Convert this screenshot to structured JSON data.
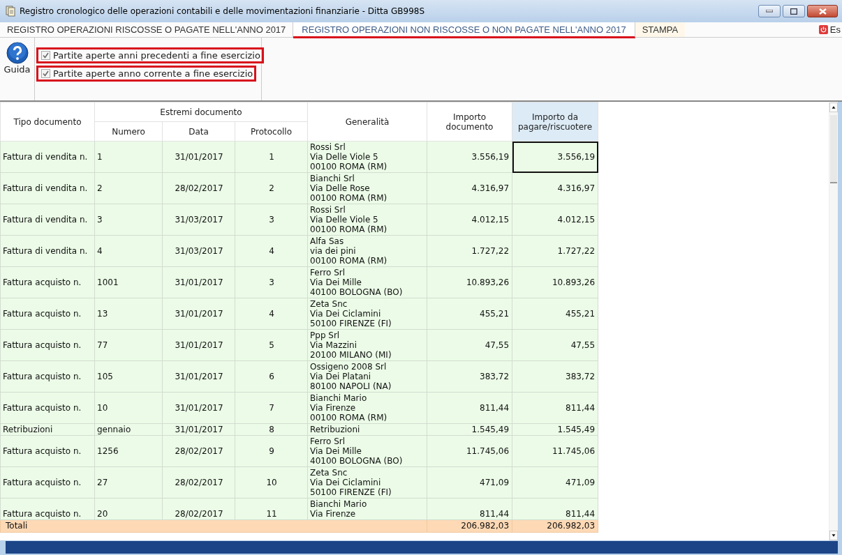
{
  "window": {
    "title": "Registro cronologico delle operazioni contabili e delle movimentazioni finanziarie - Ditta GB998S"
  },
  "tabs": [
    {
      "label": "REGISTRO OPERAZIONI RISCOSSE O PAGATE NELL'ANNO 2017",
      "selected": false
    },
    {
      "label": "REGISTRO OPERAZIONI NON RISCOSSE O NON PAGATE NELL'ANNO 2017",
      "selected": true
    },
    {
      "label": "STAMPA",
      "selected": false
    }
  ],
  "exit_button": {
    "label": "Es"
  },
  "toolbar": {
    "help_button": {
      "label": "Guida"
    },
    "filters": [
      {
        "label": "Partite aperte anni precedenti a fine esercizio",
        "checked": true
      },
      {
        "label": "Partite aperte anno corrente a fine esercizio",
        "checked": true
      }
    ]
  },
  "table": {
    "group_header": "Estremi documento",
    "columns": [
      {
        "label": "Tipo documento",
        "selected": false
      },
      {
        "label": "Numero",
        "selected": false
      },
      {
        "label": "Data",
        "selected": false
      },
      {
        "label": "Protocollo",
        "selected": false
      },
      {
        "label": "Generalità",
        "selected": false
      },
      {
        "label": "Importo documento",
        "selected": false
      },
      {
        "label": "Importo da pagare/riscuotere",
        "selected": true
      }
    ],
    "rows": [
      {
        "type": "Fattura di vendita n.",
        "number": "1",
        "date": "31/01/2017",
        "protocol": "1",
        "party": [
          "Rossi Srl",
          "Via Delle Viole 5",
          "00100 ROMA (RM)"
        ],
        "amount": "3.556,19",
        "due": "3.556,19",
        "selected": true
      },
      {
        "type": "Fattura di vendita n.",
        "number": "2",
        "date": "28/02/2017",
        "protocol": "2",
        "party": [
          "Bianchi Srl",
          "Via Delle Rose",
          "00100 ROMA (RM)"
        ],
        "amount": "4.316,97",
        "due": "4.316,97",
        "selected": false
      },
      {
        "type": "Fattura di vendita n.",
        "number": "3",
        "date": "31/03/2017",
        "protocol": "3",
        "party": [
          "Rossi Srl",
          "Via Delle Viole 5",
          "00100 ROMA (RM)"
        ],
        "amount": "4.012,15",
        "due": "4.012,15",
        "selected": false
      },
      {
        "type": "Fattura di vendita n.",
        "number": "4",
        "date": "31/03/2017",
        "protocol": "4",
        "party": [
          "Alfa Sas",
          "via dei pini",
          "00100 ROMA (RM)"
        ],
        "amount": "1.727,22",
        "due": "1.727,22",
        "selected": false
      },
      {
        "type": "Fattura acquisto n.",
        "number": "1001",
        "date": "31/01/2017",
        "protocol": "3",
        "party": [
          "Ferro Srl",
          "Via Dei Mille",
          "40100 BOLOGNA (BO)"
        ],
        "amount": "10.893,26",
        "due": "10.893,26",
        "selected": false
      },
      {
        "type": "Fattura acquisto n.",
        "number": "13",
        "date": "31/01/2017",
        "protocol": "4",
        "party": [
          "Zeta Snc",
          "Via Dei Ciclamini",
          "50100 FIRENZE (FI)"
        ],
        "amount": "455,21",
        "due": "455,21",
        "selected": false
      },
      {
        "type": "Fattura acquisto n.",
        "number": "77",
        "date": "31/01/2017",
        "protocol": "5",
        "party": [
          "Ppp Srl",
          "Via Mazzini",
          "20100 MILANO (MI)"
        ],
        "amount": "47,55",
        "due": "47,55",
        "selected": false
      },
      {
        "type": "Fattura acquisto n.",
        "number": "105",
        "date": "31/01/2017",
        "protocol": "6",
        "party": [
          "Ossigeno 2008 Srl",
          "Via Dei Platani",
          "80100 NAPOLI (NA)"
        ],
        "amount": "383,72",
        "due": "383,72",
        "selected": false
      },
      {
        "type": "Fattura acquisto n.",
        "number": "10",
        "date": "31/01/2017",
        "protocol": "7",
        "party": [
          "Bianchi Mario",
          "Via Firenze",
          "00100 ROMA (RM)"
        ],
        "amount": "811,44",
        "due": "811,44",
        "selected": false
      },
      {
        "type": "Retribuzioni",
        "number": "gennaio",
        "date": "31/01/2017",
        "protocol": "8",
        "party": [
          "Retribuzioni"
        ],
        "amount": "1.545,49",
        "due": "1.545,49",
        "selected": false
      },
      {
        "type": "Fattura acquisto n.",
        "number": "1256",
        "date": "28/02/2017",
        "protocol": "9",
        "party": [
          "Ferro Srl",
          "Via Dei Mille",
          "40100 BOLOGNA (BO)"
        ],
        "amount": "11.745,06",
        "due": "11.745,06",
        "selected": false
      },
      {
        "type": "Fattura acquisto n.",
        "number": "27",
        "date": "28/02/2017",
        "protocol": "10",
        "party": [
          "Zeta Snc",
          "Via Dei Ciclamini",
          "50100 FIRENZE (FI)"
        ],
        "amount": "471,09",
        "due": "471,09",
        "selected": false
      },
      {
        "type": "Fattura acquisto n.",
        "number": "20",
        "date": "28/02/2017",
        "protocol": "11",
        "party": [
          "Bianchi Mario",
          "Via Firenze"
        ],
        "amount": "811,44",
        "due": "811,44",
        "selected": false
      }
    ],
    "totals": {
      "label": "Totali",
      "amount": "206.982,03",
      "due": "206.982,03"
    }
  }
}
